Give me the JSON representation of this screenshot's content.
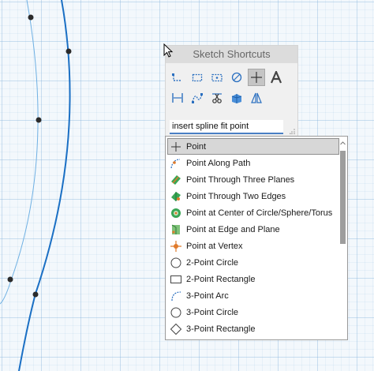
{
  "panel": {
    "title": "Sketch Shortcuts",
    "search_value": "insert spline fit point",
    "tools_row1": [
      {
        "icon": "polyline-icon"
      },
      {
        "icon": "rectangle-icon"
      },
      {
        "icon": "slot-icon"
      },
      {
        "icon": "circle-icon"
      },
      {
        "icon": "point-tool-icon",
        "active": true
      },
      {
        "icon": "text-icon"
      }
    ],
    "tools_row2": [
      {
        "icon": "dimension-icon"
      },
      {
        "icon": "spline-icon"
      },
      {
        "icon": "trim-icon"
      },
      {
        "icon": "extrude-icon"
      },
      {
        "icon": "mirror-icon"
      }
    ]
  },
  "dropdown": {
    "selected_index": 0,
    "items": [
      {
        "label": "Point",
        "icon": "point-icon"
      },
      {
        "label": "Point Along Path",
        "icon": "point-along-path-icon"
      },
      {
        "label": "Point Through Three Planes",
        "icon": "three-planes-icon"
      },
      {
        "label": "Point Through Two Edges",
        "icon": "two-edges-icon"
      },
      {
        "label": "Point at Center of Circle/Sphere/Torus",
        "icon": "center-point-icon"
      },
      {
        "label": "Point at Edge and Plane",
        "icon": "edge-plane-icon"
      },
      {
        "label": "Point at Vertex",
        "icon": "vertex-icon"
      },
      {
        "label": "2-Point Circle",
        "icon": "circle-icon"
      },
      {
        "label": "2-Point Rectangle",
        "icon": "rectangle-icon"
      },
      {
        "label": "3-Point Arc",
        "icon": "arc-icon"
      },
      {
        "label": "3-Point Circle",
        "icon": "circle-icon"
      },
      {
        "label": "3-Point Rectangle",
        "icon": "rotated-rectangle-icon"
      }
    ]
  },
  "colors": {
    "grid": "#78aad7",
    "curve": "#1a6fc4",
    "accent": "#4a7fc4",
    "orange": "#e07a2a",
    "green": "#3aa655"
  }
}
